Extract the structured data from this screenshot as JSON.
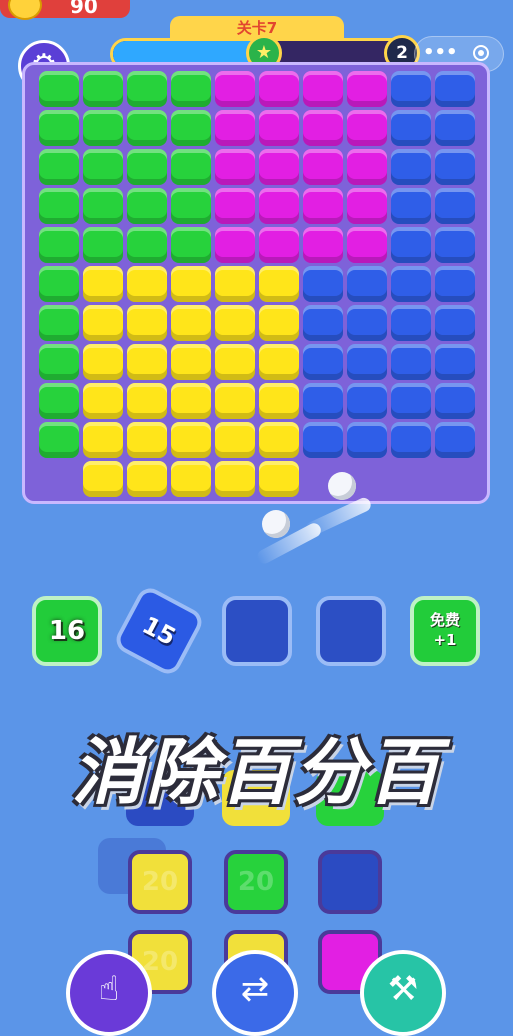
{
  "top_bar": {
    "coin_count": "90",
    "level_label": "关卡7",
    "progress_fraction": 0.5,
    "next_level": "2",
    "star_icon": "star-icon",
    "settings_icon": "gear-icon",
    "more_icon": "more-dots-icon",
    "record_icon": "record-icon"
  },
  "board": {
    "colors": {
      "green": "#27d23c",
      "magenta": "#e21fe3",
      "blue": "#2f5ee8",
      "yellow": "#ffe51a"
    }
  },
  "slots": [
    {
      "type": "cube",
      "color": "green",
      "label": "16"
    },
    {
      "type": "cube",
      "color": "blue",
      "label": "15"
    },
    {
      "type": "empty"
    },
    {
      "type": "empty"
    },
    {
      "type": "free",
      "label_line1": "免费",
      "label_line2": "+1"
    }
  ],
  "banner": {
    "text": "消除百分百"
  },
  "queue_labels": [
    "20",
    "20",
    "20",
    "20"
  ],
  "tools": [
    {
      "icon": "pointer-hand-icon"
    },
    {
      "icon": "shuffle-arrows-icon"
    },
    {
      "icon": "hammer-icon"
    }
  ]
}
